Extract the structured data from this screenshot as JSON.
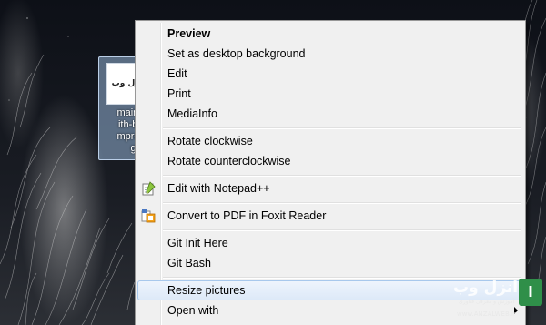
{
  "desktop": {
    "icon": {
      "thumbnail_text": "انزل وب",
      "caption_lines": [
        "main-lo",
        "ith-bac",
        "mpress",
        "g"
      ]
    }
  },
  "context_menu": {
    "items": [
      {
        "label": "Preview",
        "bold": true
      },
      {
        "label": "Set as desktop background"
      },
      {
        "label": "Edit"
      },
      {
        "label": "Print"
      },
      {
        "label": "MediaInfo"
      },
      {
        "label": "Rotate clockwise"
      },
      {
        "label": "Rotate counterclockwise"
      },
      {
        "label": "Edit with Notepad++",
        "icon": "notepad-plus-plus-icon"
      },
      {
        "label": "Convert to PDF in Foxit Reader",
        "icon": "foxit-reader-icon"
      },
      {
        "label": "Git Init Here"
      },
      {
        "label": "Git Bash"
      },
      {
        "label": "Resize pictures",
        "highlighted": true
      },
      {
        "label": "Open with",
        "submenu": true
      }
    ]
  },
  "watermark": {
    "brand": "انزل وب",
    "tagline": "آموزش و معرفی فناوری",
    "site": "www.ANZALWEB.ir",
    "logo_letter": "ا"
  }
}
